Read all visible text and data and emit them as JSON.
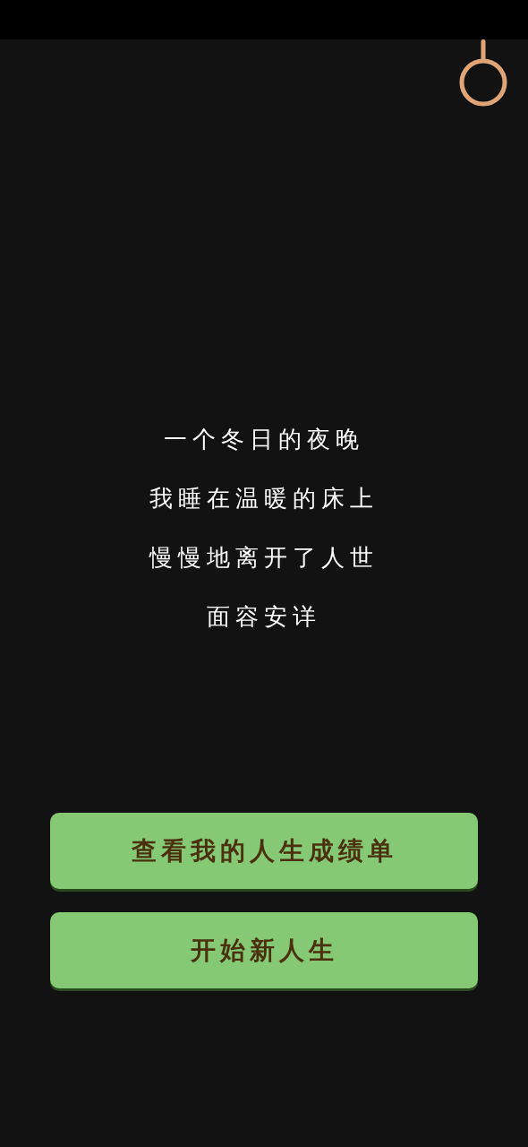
{
  "lines": [
    "一个冬日的夜晚",
    "我睡在温暖的床上",
    "慢慢地离开了人世",
    "面容安详"
  ],
  "buttons": [
    {
      "label": "查看我的人生成绩单"
    },
    {
      "label": "开始新人生"
    }
  ]
}
